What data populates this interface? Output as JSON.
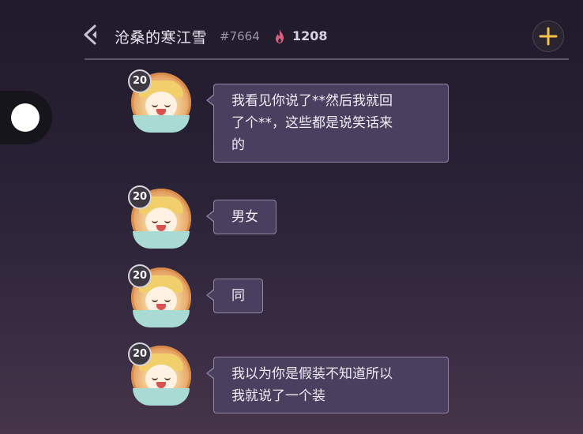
{
  "header": {
    "title": "沧桑的寒江雪",
    "tag": "#7664",
    "heat_value": "1208"
  },
  "messages": [
    {
      "level": "20",
      "text_line1": "我看见你说了**然后我就回",
      "text_line2": "了个**，这些都是说笑话来",
      "text_line3": "的"
    },
    {
      "level": "20",
      "text_line1": "男女"
    },
    {
      "level": "20",
      "text_line1": "同"
    },
    {
      "level": "20",
      "text_line1": "我以为你是假装不知道所以",
      "text_line2": "我就说了一个装"
    }
  ],
  "icons": {
    "back": "chevron-left-icon",
    "heat": "flame-icon",
    "add": "plus-icon"
  },
  "colors": {
    "bubble_bg": "#4a3f5e",
    "bubble_border": "#8f87a3",
    "add_icon": "#f2c24a"
  }
}
